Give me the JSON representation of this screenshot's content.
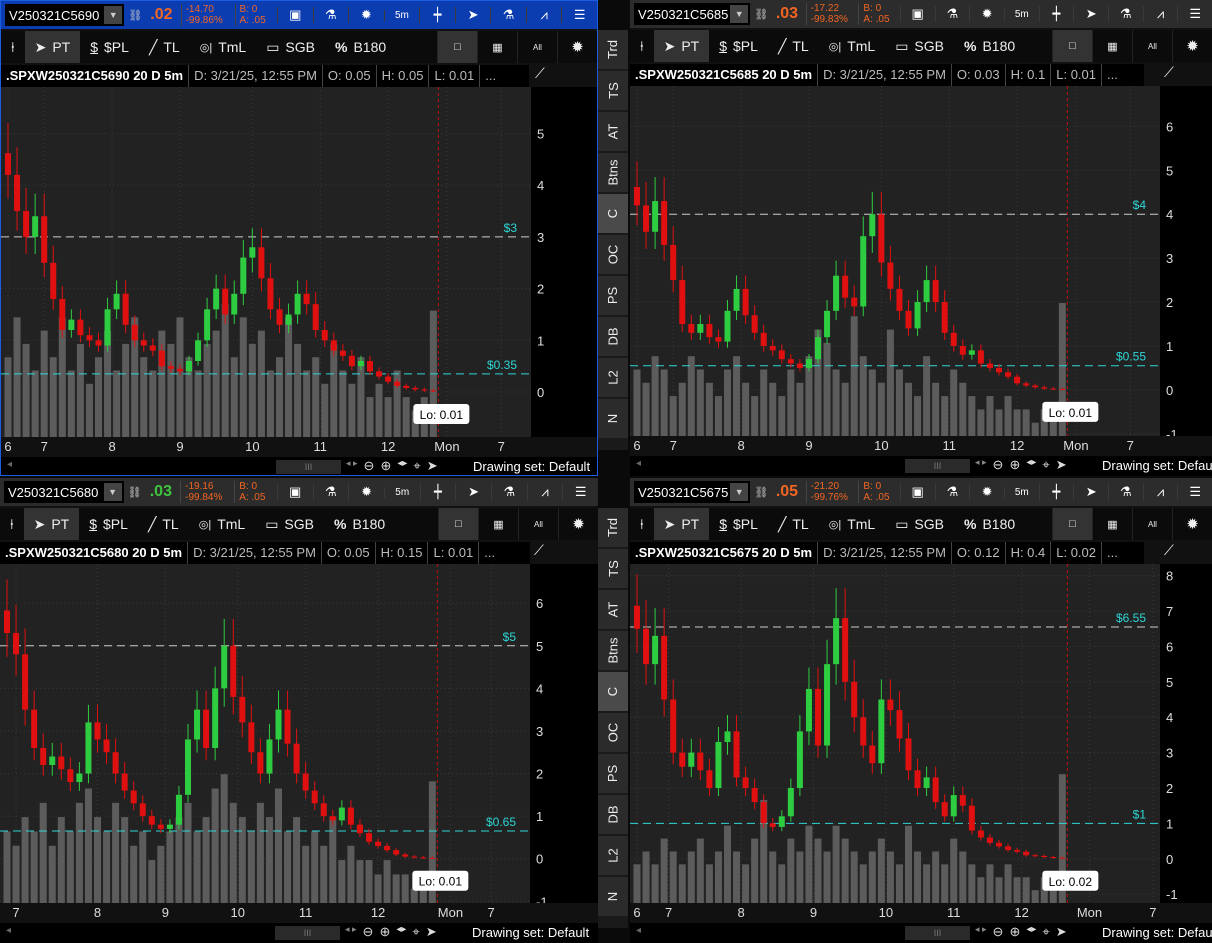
{
  "side_tabs": [
    "Trd",
    "TS",
    "AT",
    "Btns",
    "C",
    "OC",
    "PS",
    "DB",
    "L2",
    "N"
  ],
  "side_active": "C",
  "colors": {
    "up": "#2ecc40",
    "down": "#e01010",
    "hline": "#2fd6d6",
    "volume": "#5c5c5c",
    "active_header": "#0c3db0",
    "price_orange": "#f26522",
    "price_green": "#3fc43f"
  },
  "toolbar": {
    "pin": "pin-icon",
    "pt": "PT",
    "pl": "$PL",
    "tl": "TL",
    "tml": "TmL",
    "sgb": "SGB",
    "b180": "B180",
    "b180_icon": "%",
    "pl_icon": "$",
    "all": "All"
  },
  "header_buttons": {
    "interval": "5m"
  },
  "footer": {
    "drawing_set": "Drawing set: Default",
    "thumb": "III"
  },
  "panels": [
    {
      "symbol": "V250321C5690",
      "last": ".02",
      "last_dir": "down",
      "change": "-14.70",
      "change_pct": "-99.86%",
      "bid": "B: 0",
      "ask": "A: .05",
      "title": ".SPXW250321C5690 20 D 5m",
      "date": "D: 3/21/25, 12:55 PM",
      "open": "O: 0.05",
      "high": "H: 0.05",
      "low": "L: 0.01",
      "more": "...",
      "lo_label": "Lo: 0.01",
      "chart_data": {
        "type": "candlestick",
        "ylim": [
          -0.87,
          5.9
        ],
        "y_ticks": [
          0,
          1,
          2,
          3,
          4,
          5
        ],
        "hlines": [
          {
            "value": 3,
            "label": "$3"
          },
          {
            "value": 0.35,
            "label": "$0.35"
          }
        ],
        "closes": [
          4.2,
          3.5,
          3.0,
          3.4,
          2.5,
          1.8,
          1.2,
          1.4,
          1.1,
          1.0,
          0.9,
          1.6,
          1.9,
          1.3,
          1.0,
          0.9,
          0.8,
          0.5,
          0.45,
          0.4,
          0.6,
          1.0,
          1.6,
          2.0,
          1.5,
          1.9,
          2.6,
          2.8,
          2.2,
          1.6,
          1.3,
          1.5,
          1.9,
          1.7,
          1.2,
          1.0,
          0.8,
          0.7,
          0.5,
          0.6,
          0.4,
          0.3,
          0.2,
          0.12,
          0.08,
          0.05,
          0.03,
          0.01
        ],
        "volume": [
          0.6,
          0.9,
          0.7,
          0.5,
          0.8,
          0.6,
          0.9,
          0.5,
          0.7,
          0.4,
          0.6,
          0.8,
          0.5,
          0.7,
          0.9,
          0.6,
          0.5,
          0.8,
          0.7,
          0.9,
          0.6,
          0.5,
          0.7,
          0.8,
          1.0,
          0.6,
          0.9,
          0.7,
          0.8,
          0.5,
          0.6,
          0.9,
          0.7,
          0.5,
          0.6,
          0.4,
          0.7,
          0.5,
          0.4,
          0.6,
          0.3,
          0.4,
          0.3,
          0.5,
          0.3,
          0.2,
          0.3,
          0.95
        ],
        "x_labels": [
          {
            "label": "6",
            "bar": 0
          },
          {
            "label": "7",
            "bar": 4
          },
          {
            "label": "8",
            "bar": 11.5
          },
          {
            "label": "9",
            "bar": 19
          },
          {
            "label": "10",
            "bar": 27
          },
          {
            "label": "11",
            "bar": 34.5
          },
          {
            "label": "12",
            "bar": 42
          },
          {
            "label": "Mon",
            "bar": 48.5
          },
          {
            "label": "7",
            "bar": 54.5
          }
        ]
      }
    },
    {
      "symbol": "V250321C5685",
      "last": ".03",
      "last_dir": "down",
      "change": "-17.22",
      "change_pct": "-99.83%",
      "bid": "B: 0",
      "ask": "A: .05",
      "title": ".SPXW250321C5685 20 D 5m",
      "date": "D: 3/21/25, 12:55 PM",
      "open": "O: 0.03",
      "high": "H: 0.1",
      "low": "L: 0.01",
      "more": "...",
      "lo_label": "Lo: 0.01",
      "chart_data": {
        "type": "candlestick",
        "ylim": [
          -1.05,
          6.92
        ],
        "y_ticks": [
          -1,
          0,
          1,
          2,
          3,
          4,
          5,
          6
        ],
        "hlines": [
          {
            "value": 4,
            "label": "$4"
          },
          {
            "value": 0.55,
            "label": "$0.55"
          }
        ],
        "closes": [
          4.2,
          3.6,
          4.3,
          3.3,
          2.5,
          1.5,
          1.3,
          1.5,
          1.2,
          1.1,
          1.8,
          2.3,
          1.7,
          1.3,
          1.0,
          0.9,
          0.7,
          0.6,
          0.5,
          0.7,
          1.2,
          1.8,
          2.6,
          2.1,
          1.9,
          3.5,
          4.0,
          2.9,
          2.3,
          1.8,
          1.4,
          2.0,
          2.5,
          2.0,
          1.3,
          1.0,
          0.8,
          0.9,
          0.6,
          0.5,
          0.4,
          0.3,
          0.15,
          0.1,
          0.06,
          0.03,
          0.02,
          0.01
        ],
        "volume": [
          0.5,
          0.4,
          0.6,
          0.5,
          0.3,
          0.4,
          0.6,
          0.5,
          0.4,
          0.3,
          0.5,
          0.6,
          0.4,
          0.3,
          0.5,
          0.4,
          0.3,
          0.5,
          0.4,
          0.6,
          0.8,
          0.7,
          0.5,
          0.4,
          0.9,
          0.6,
          0.5,
          0.4,
          0.8,
          0.5,
          0.4,
          0.3,
          0.6,
          0.4,
          0.3,
          0.5,
          0.4,
          0.3,
          0.2,
          0.3,
          0.2,
          0.3,
          0.2,
          0.2,
          0.1,
          0.2,
          0.2,
          1.0
        ],
        "x_labels": [
          {
            "label": "6",
            "bar": 0
          },
          {
            "label": "7",
            "bar": 4
          },
          {
            "label": "8",
            "bar": 11.5
          },
          {
            "label": "9",
            "bar": 19
          },
          {
            "label": "10",
            "bar": 27
          },
          {
            "label": "11",
            "bar": 34.5
          },
          {
            "label": "12",
            "bar": 42
          },
          {
            "label": "Mon",
            "bar": 48.5
          },
          {
            "label": "7",
            "bar": 54.5
          }
        ]
      }
    },
    {
      "symbol": "V250321C5680",
      "last": ".03",
      "last_dir": "up",
      "change": "-19.16",
      "change_pct": "-99.84%",
      "bid": "B: 0",
      "ask": "A: .05",
      "title": ".SPXW250321C5680 20 D 5m",
      "date": "D: 3/21/25, 12:55 PM",
      "open": "O: 0.05",
      "high": "H: 0.15",
      "low": "L: 0.01",
      "more": "...",
      "lo_label": "Lo: 0.01",
      "chart_data": {
        "type": "candlestick",
        "ylim": [
          -1.04,
          6.92
        ],
        "y_ticks": [
          -1,
          0,
          1,
          2,
          3,
          4,
          5,
          6
        ],
        "hlines": [
          {
            "value": 5,
            "label": "$5"
          },
          {
            "value": 0.65,
            "label": "$0.65"
          }
        ],
        "closes": [
          5.3,
          4.8,
          3.5,
          2.6,
          2.2,
          2.4,
          2.1,
          1.8,
          2.0,
          3.2,
          2.8,
          2.5,
          2.0,
          1.6,
          1.3,
          1.0,
          0.8,
          0.7,
          0.8,
          1.5,
          2.8,
          3.5,
          2.6,
          4.0,
          5.0,
          3.8,
          3.2,
          2.5,
          2.0,
          2.8,
          3.5,
          2.7,
          2.0,
          1.6,
          1.3,
          1.0,
          0.9,
          1.2,
          0.8,
          0.6,
          0.4,
          0.3,
          0.2,
          0.1,
          0.05,
          0.03,
          0.02,
          0.01
        ],
        "volume": [
          0.5,
          0.4,
          0.6,
          0.5,
          0.7,
          0.4,
          0.6,
          0.5,
          0.7,
          0.8,
          0.6,
          0.5,
          0.7,
          0.6,
          0.4,
          0.5,
          0.3,
          0.4,
          0.5,
          0.6,
          0.7,
          0.5,
          0.6,
          0.8,
          0.9,
          0.7,
          0.6,
          0.5,
          0.7,
          0.6,
          0.8,
          0.5,
          0.6,
          0.4,
          0.5,
          0.4,
          0.6,
          0.3,
          0.4,
          0.3,
          0.3,
          0.2,
          0.3,
          0.2,
          0.2,
          0.1,
          0.2,
          0.85
        ],
        "x_labels": [
          {
            "label": "7",
            "bar": 1
          },
          {
            "label": "8",
            "bar": 10
          },
          {
            "label": "9",
            "bar": 17.5
          },
          {
            "label": "10",
            "bar": 25.5
          },
          {
            "label": "11",
            "bar": 33
          },
          {
            "label": "12",
            "bar": 41
          },
          {
            "label": "Mon",
            "bar": 49
          },
          {
            "label": "7",
            "bar": 53.5
          }
        ]
      }
    },
    {
      "symbol": "V250321C5675",
      "last": ".05",
      "last_dir": "down",
      "change": "-21.20",
      "change_pct": "-99.76%",
      "bid": "B: 0",
      "ask": "A: .05",
      "title": ".SPXW250321C5675 20 D 5m",
      "date": "D: 3/21/25, 12:55 PM",
      "open": "O: 0.12",
      "high": "H: 0.4",
      "low": "L: 0.02",
      "more": "...",
      "lo_label": "Lo: 0.02",
      "chart_data": {
        "type": "candlestick",
        "ylim": [
          -1.25,
          8.33
        ],
        "y_ticks": [
          -1,
          0,
          1,
          2,
          3,
          4,
          5,
          6,
          7,
          8
        ],
        "hlines": [
          {
            "value": 6.55,
            "label": "$6.55"
          },
          {
            "value": 1,
            "label": "$1"
          }
        ],
        "closes": [
          6.5,
          5.5,
          6.3,
          4.5,
          3.0,
          2.6,
          3.0,
          2.5,
          2.0,
          3.3,
          3.6,
          2.3,
          2.0,
          1.6,
          1.0,
          0.9,
          1.2,
          2.0,
          3.6,
          4.8,
          3.2,
          5.5,
          6.8,
          5.0,
          4.0,
          3.2,
          2.7,
          4.5,
          4.2,
          3.4,
          2.5,
          2.0,
          2.3,
          1.6,
          1.2,
          1.8,
          1.5,
          0.8,
          0.6,
          0.45,
          0.35,
          0.25,
          0.2,
          0.1,
          0.08,
          0.05,
          0.03,
          0.02
        ],
        "volume": [
          0.3,
          0.4,
          0.3,
          0.5,
          0.4,
          0.3,
          0.4,
          0.5,
          0.3,
          0.4,
          0.6,
          0.4,
          0.3,
          0.5,
          0.8,
          0.4,
          0.3,
          0.5,
          0.4,
          0.6,
          0.5,
          0.4,
          0.6,
          0.5,
          0.4,
          0.3,
          0.4,
          0.5,
          0.4,
          0.3,
          0.6,
          0.4,
          0.3,
          0.4,
          0.3,
          0.5,
          0.4,
          0.3,
          0.2,
          0.3,
          0.2,
          0.3,
          0.2,
          0.2,
          0.1,
          0.2,
          0.2,
          1.0
        ],
        "x_labels": [
          {
            "label": "6",
            "bar": 0
          },
          {
            "label": "7",
            "bar": 3.5
          },
          {
            "label": "8",
            "bar": 11.5
          },
          {
            "label": "9",
            "bar": 19.5
          },
          {
            "label": "10",
            "bar": 27.5
          },
          {
            "label": "11",
            "bar": 35
          },
          {
            "label": "12",
            "bar": 42.5
          },
          {
            "label": "Mon",
            "bar": 50
          },
          {
            "label": "7",
            "bar": 57
          }
        ]
      }
    }
  ]
}
